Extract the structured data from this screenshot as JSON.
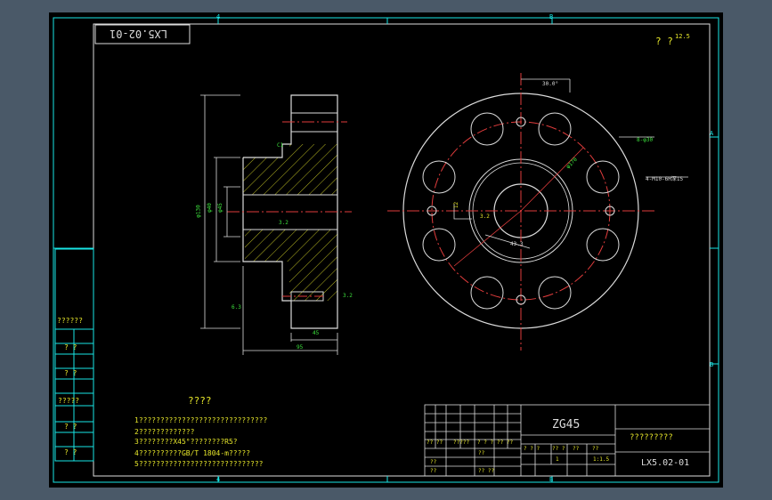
{
  "drawing": {
    "code_stamp": "LX5.02-01",
    "roughness_note": "? ?",
    "roughness_value": "12.5",
    "border_letters": {
      "top_left": "4",
      "top_right": "B",
      "right_upper": "A",
      "right_lower": "B",
      "bottom_left": "4",
      "bottom_right": "B"
    },
    "section_dims": {
      "outer_dia": "φ130",
      "bore_dia": "φ40",
      "hub_dia": "φ45",
      "length_1": "45",
      "length_2": "95",
      "chamfer": "C1",
      "roughness_a": "3.2",
      "roughness_b": "6.3",
      "roughness_c": "3.2",
      "roughness_d": "1.6"
    },
    "front_dims": {
      "angle": "30.0°",
      "bolt_circle": "φ170",
      "holes": "8-φ30",
      "pin_holes": "4-M10-6H深15",
      "keyway": "12",
      "key_depth": "43.3",
      "roughness_e": "3.2",
      "roughness_f": "6.3"
    }
  },
  "left_labels": [
    "??????",
    "?  ?",
    "?  ?",
    "?????",
    "?  ?",
    "?  ?"
  ],
  "notes": {
    "title": "????",
    "lines": [
      "1??????????????????????????????",
      "2?????????????",
      "3????????X45°????????R5?",
      "4??????????GB/T 1804-m?????",
      "5?????????????????????????????"
    ]
  },
  "title_block": {
    "material": "ZG45",
    "part_name": "?????????",
    "drawing_no": "LX5.02-01",
    "scale_label": "1:1.5",
    "qty": "1",
    "row_labels": [
      "?? ??",
      "?????",
      "? ? ?",
      "?? ??",
      "??",
      "??",
      "??",
      "?? ??"
    ],
    "small_headers": [
      "? ? ?",
      "?? ?",
      "??",
      "??"
    ]
  }
}
